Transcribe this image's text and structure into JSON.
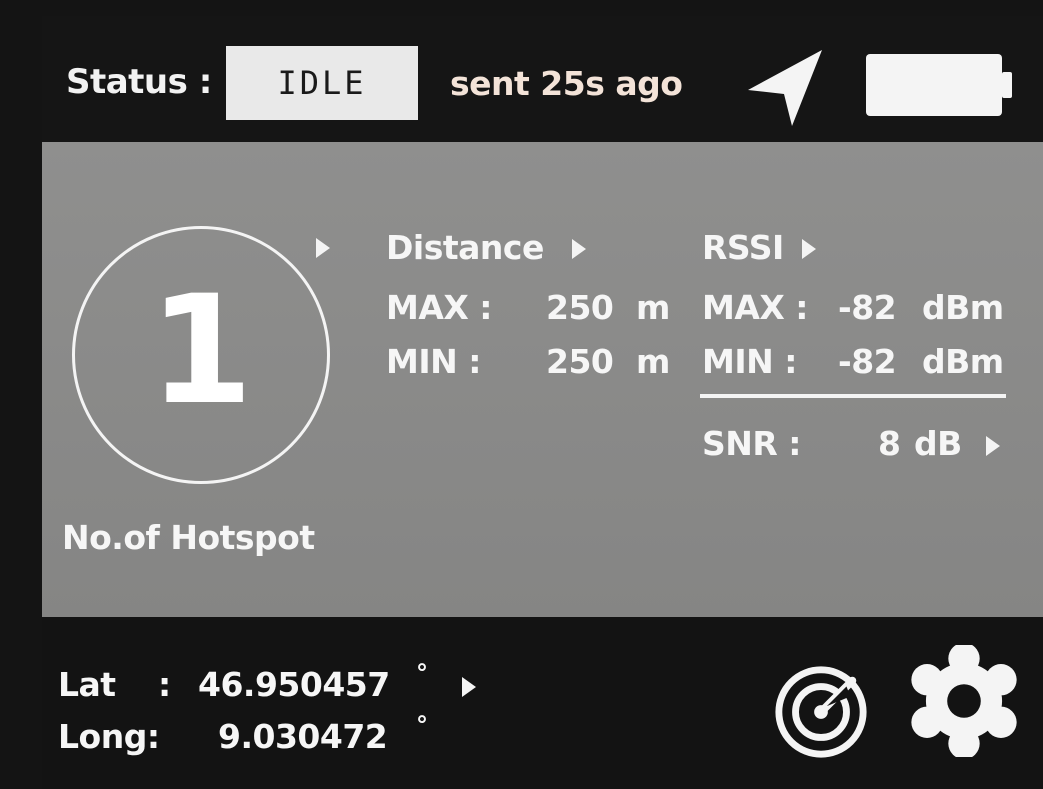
{
  "status": {
    "label": "Status :",
    "value": "IDLE",
    "sent": "sent 25s ago"
  },
  "icons": {
    "navigation": "navigation-arrow-icon",
    "battery": "battery-icon",
    "radar": "radar-icon",
    "settings": "gear-icon"
  },
  "hotspot": {
    "count": "1",
    "label": "No.of Hotspot"
  },
  "distance": {
    "title": "Distance",
    "max_label": "MAX :",
    "max_value": "250",
    "max_unit": "m",
    "min_label": "MIN :",
    "min_value": "250",
    "min_unit": "m"
  },
  "rssi": {
    "title": "RSSI",
    "max_label": "MAX :",
    "max_value": "-82",
    "max_unit": "dBm",
    "min_label": "MIN :",
    "min_value": "-82",
    "min_unit": "dBm"
  },
  "snr": {
    "label": "SNR :",
    "value": "8",
    "unit": "dB"
  },
  "location": {
    "lat_label": "Lat",
    "lat_sep": ":",
    "lat_value": "46.950457",
    "long_label": "Long:",
    "long_value": "9.030472",
    "degree": "°"
  },
  "colors": {
    "panel": "#8a8a89",
    "bar": "#141414",
    "status_box": "#e9e9e9",
    "text": "#f6f6f6",
    "sent_text": "#f3e3d8"
  }
}
